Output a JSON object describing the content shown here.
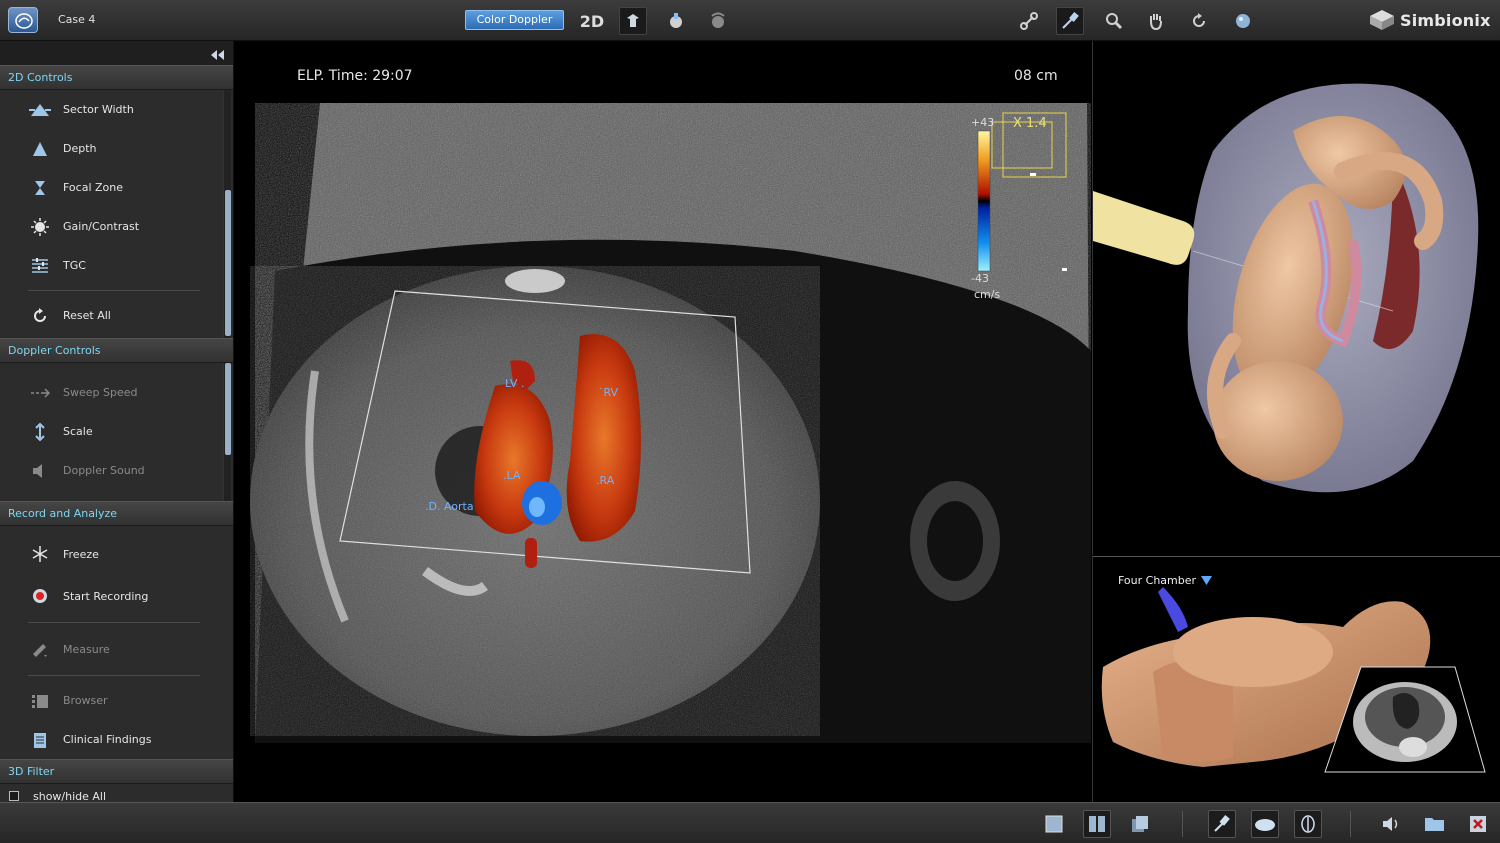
{
  "topbar": {
    "case_label": "Case 4",
    "mode_button": "Color Doppler",
    "dimension_label": "2D",
    "brand_name": "Simbionix"
  },
  "left_panel": {
    "sections": {
      "controls_2d": {
        "title": "2D Controls",
        "items": [
          "Sector Width",
          "Depth",
          "Focal Zone",
          "Gain/Contrast",
          "TGC"
        ],
        "reset_label": "Reset All"
      },
      "doppler": {
        "title": "Doppler Controls",
        "items": [
          "Sweep Speed",
          "Scale",
          "Doppler Sound"
        ]
      },
      "record": {
        "title": "Record and Analyze",
        "freeze": "Freeze",
        "start_recording": "Start Recording",
        "measure": "Measure",
        "browser": "Browser",
        "clinical_findings": "Clinical Findings"
      },
      "filter_3d": {
        "title": "3D Filter",
        "show_hide": "show/hide All"
      }
    }
  },
  "ultrasound": {
    "elp_time": "ELP. Time: 29:07",
    "depth": "08 cm",
    "scale_max": "+43",
    "scale_min": "-43",
    "scale_unit": "cm/s",
    "zoom": "X 1.4",
    "labels": {
      "lv": "LV",
      "rv": "RV",
      "la": "LA",
      "ra": "RA",
      "aorta": "D. Aorta"
    },
    "colors": {
      "flow_red": "#c0300a",
      "flow_orange": "#e0781a",
      "flow_blue": "#1e6fe0"
    }
  },
  "views": {
    "plane_label": "Four Chamber"
  },
  "theme": {
    "accent": "#7fd6f2",
    "panel_bg": "#2c2c2c",
    "skin": "#d9a67f"
  }
}
